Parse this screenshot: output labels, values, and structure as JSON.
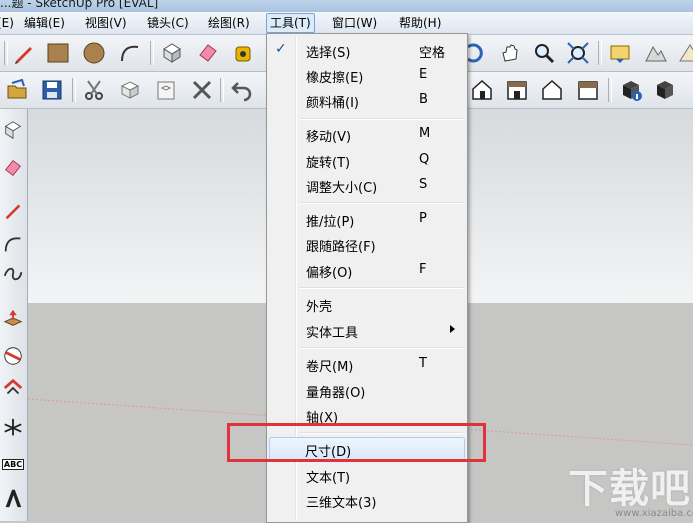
{
  "window": {
    "title": "...题 - SketchUp Pro [EVAL]"
  },
  "menubar": {
    "items": [
      {
        "label": "(E)"
      },
      {
        "label": "编辑(E)"
      },
      {
        "label": "视图(V)"
      },
      {
        "label": "镜头(C)"
      },
      {
        "label": "绘图(R)"
      },
      {
        "label": "工具(T)"
      },
      {
        "label": "窗口(W)"
      },
      {
        "label": "帮助(H)"
      }
    ]
  },
  "tools_menu": {
    "items": [
      {
        "label": "选择(S)",
        "shortcut": "空格",
        "checked": true
      },
      {
        "label": "橡皮擦(E)",
        "shortcut": "E"
      },
      {
        "label": "颜料桶(I)",
        "shortcut": "B"
      },
      {
        "label": "移动(V)",
        "shortcut": "M"
      },
      {
        "label": "旋转(T)",
        "shortcut": "Q"
      },
      {
        "label": "调整大小(C)",
        "shortcut": "S"
      },
      {
        "label": "推/拉(P)",
        "shortcut": "P"
      },
      {
        "label": "跟随路径(F)",
        "shortcut": ""
      },
      {
        "label": "偏移(O)",
        "shortcut": "F"
      },
      {
        "label": "外壳",
        "shortcut": ""
      },
      {
        "label": "实体工具",
        "shortcut": "",
        "submenu": true
      },
      {
        "label": "卷尺(M)",
        "shortcut": "T"
      },
      {
        "label": "量角器(O)",
        "shortcut": ""
      },
      {
        "label": "轴(X)",
        "shortcut": ""
      },
      {
        "label": "尺寸(D)",
        "shortcut": "",
        "highlighted": true
      },
      {
        "label": "文本(T)",
        "shortcut": ""
      },
      {
        "label": "三维文本(3)",
        "shortcut": ""
      }
    ]
  },
  "left_toolbar": {
    "text_tool_label": "ABC"
  },
  "watermark": {
    "text": "下载吧",
    "url": "www.xiazaiba.com"
  },
  "colors": {
    "highlight_border": "#e0323a",
    "menu_active": "#dcebfa",
    "check_mark": "#1c4f9c"
  }
}
